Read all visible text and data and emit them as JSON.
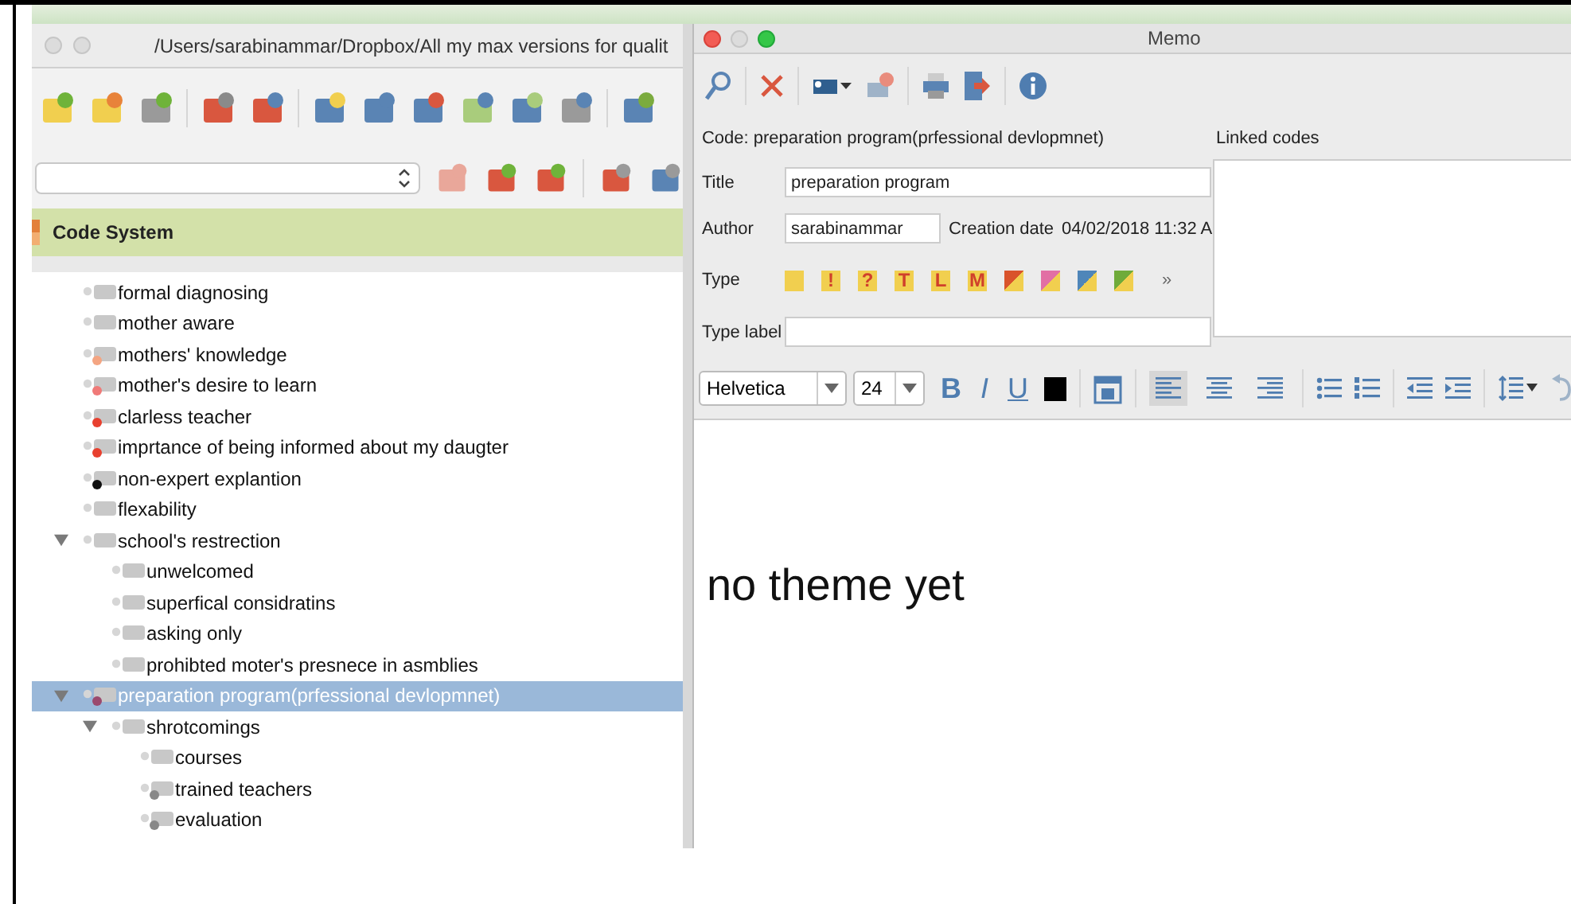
{
  "code_window": {
    "title": "/Users/sarabinammar/Dropbox/All my max versions for qualit",
    "header": "Code System",
    "tree": [
      {
        "label": "formal diagnosing",
        "selected": false
      },
      {
        "label": "mother aware",
        "selected": false
      },
      {
        "label": "mothers' knowledge",
        "color": "#f4a582",
        "selected": false
      },
      {
        "label": "mother's desire to learn",
        "color": "#f07a78",
        "selected": false
      },
      {
        "label": "clarless teacher",
        "color": "#e8402f",
        "selected": false
      },
      {
        "label": "imprtance of being informed about my daugter",
        "color": "#e8402f",
        "selected": false
      },
      {
        "label": "non-expert explantion",
        "color": "#111111",
        "selected": false
      },
      {
        "label": "flexability",
        "selected": false
      },
      {
        "label": "school's restrection",
        "selected": false,
        "expanded": true,
        "children": [
          {
            "label": "unwelcomed",
            "selected": false
          },
          {
            "label": "superfical considratins",
            "selected": false
          },
          {
            "label": "asking only",
            "selected": false
          },
          {
            "label": "prohibted moter's presnece in asmblies",
            "selected": false
          }
        ]
      },
      {
        "label": "preparation program(prfessional devlopmnet)",
        "color": "#9b4a6e",
        "selected": true,
        "expanded": true,
        "children": [
          {
            "label": "shrotcomings",
            "selected": false,
            "expanded": true,
            "children": [
              {
                "label": "courses",
                "selected": false
              },
              {
                "label": "trained teachers",
                "color": "#888888",
                "selected": false
              },
              {
                "label": "evaluation",
                "color": "#888888",
                "selected": false
              }
            ]
          }
        ]
      }
    ]
  },
  "memo": {
    "title": "Memo",
    "code_line": "Code: preparation program(prfessional devlopmnet)",
    "linked_codes": "Linked codes",
    "title_label": "Title",
    "title_value": "preparation program",
    "author_label": "Author",
    "author_value": "sarabinammar",
    "date_label": "Creation date",
    "date_value": "04/02/2018 11:32 A",
    "type_label": "Type",
    "type_more": "»",
    "types": [
      {
        "kind": "plain"
      },
      {
        "kind": "glyph",
        "glyph": "!"
      },
      {
        "kind": "glyph",
        "glyph": "?"
      },
      {
        "kind": "glyph",
        "glyph": "T"
      },
      {
        "kind": "glyph",
        "glyph": "L"
      },
      {
        "kind": "glyph",
        "glyph": "M"
      },
      {
        "kind": "corner",
        "color": "#d9532b"
      },
      {
        "kind": "corner",
        "color": "#e26fa4"
      },
      {
        "kind": "corner",
        "color": "#4f86b9"
      },
      {
        "kind": "corner",
        "color": "#6fab3a"
      }
    ],
    "type_label_label": "Type label",
    "font": "Helvetica",
    "size": "24",
    "styles": [
      "B",
      "I",
      "U"
    ],
    "alignments": [
      {
        "selected": true
      },
      {
        "selected": false
      },
      {
        "selected": false
      }
    ],
    "text": "no theme yet"
  }
}
